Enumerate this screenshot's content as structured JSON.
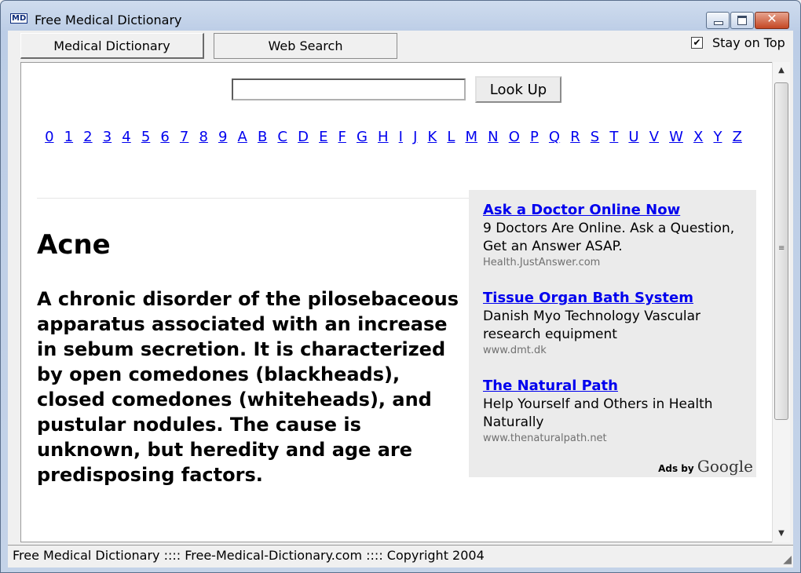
{
  "window": {
    "icon_text": "MD",
    "title": "Free Medical Dictionary",
    "buttons": {
      "minimize_icon": "minimize-icon",
      "maximize_icon": "maximize-icon",
      "close_icon": "close-icon",
      "close_glyph": "✕"
    }
  },
  "tabs": [
    {
      "label": "Medical Dictionary",
      "active": true
    },
    {
      "label": "Web Search",
      "active": false
    }
  ],
  "stay_on_top": {
    "label": "Stay on Top",
    "checked": true,
    "check_glyph": "✔"
  },
  "search": {
    "value": "",
    "button_label": "Look Up"
  },
  "index_letters": [
    "0",
    "1",
    "2",
    "3",
    "4",
    "5",
    "6",
    "7",
    "8",
    "9",
    "A",
    "B",
    "C",
    "D",
    "E",
    "F",
    "G",
    "H",
    "I",
    "J",
    "K",
    "L",
    "M",
    "N",
    "O",
    "P",
    "Q",
    "R",
    "S",
    "T",
    "U",
    "V",
    "W",
    "X",
    "Y",
    "Z"
  ],
  "entry": {
    "term": "Acne",
    "definition": "A chronic disorder of the pilosebaceous apparatus associated with an increase in sebum secretion. It is characterized by open comedones (blackheads), closed comedones (whiteheads), and pustular nodules. The cause is unknown, but heredity and age are predisposing factors."
  },
  "ads": {
    "items": [
      {
        "title": "Ask a Doctor Online Now",
        "description": "9 Doctors Are Online. Ask a Question, Get an Answer ASAP.",
        "url": "Health.JustAnswer.com"
      },
      {
        "title": "Tissue Organ Bath System",
        "description": "Danish Myo Technology Vascular research equipment",
        "url": "www.dmt.dk"
      },
      {
        "title": "The Natural Path",
        "description": "Help Yourself and Others in Health Naturally",
        "url": "www.thenaturalpath.net"
      }
    ],
    "ads_by": "Ads by",
    "google": "Google"
  },
  "status_bar": "Free Medical Dictionary :::: Free-Medical-Dictionary.com :::: Copyright 2004",
  "colors": {
    "link": "#0000ee",
    "ad_background": "#ebebeb",
    "title_bar": "#c4d3e8",
    "close_button": "#c44724"
  }
}
